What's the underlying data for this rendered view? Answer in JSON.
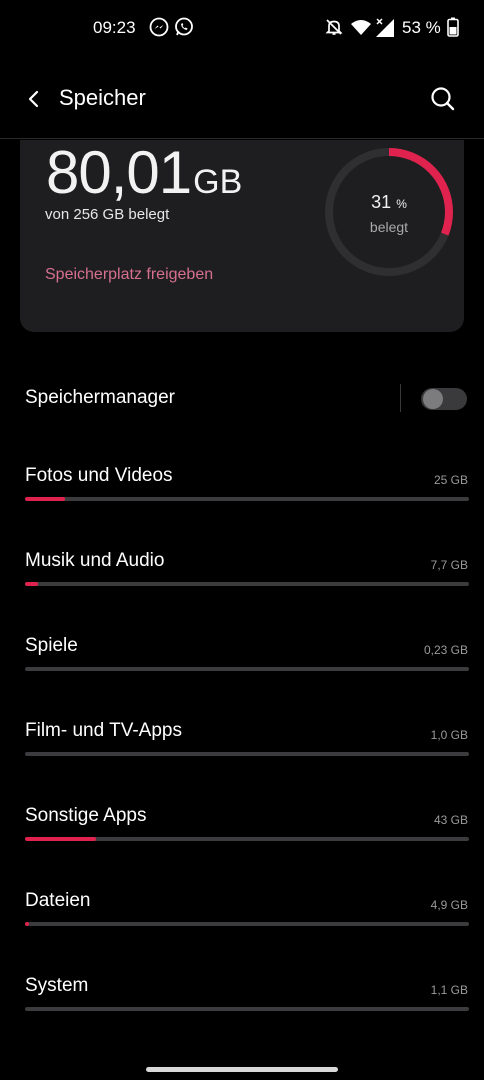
{
  "status_bar": {
    "time": "09:23",
    "battery": "53 %",
    "icons": [
      "messenger-icon",
      "whatsapp-icon",
      "bell-off-icon",
      "wifi-icon",
      "signal-icon",
      "battery-icon"
    ]
  },
  "app_bar": {
    "title": "Speicher",
    "icons": [
      "back-arrow-icon",
      "search-icon"
    ]
  },
  "summary": {
    "used_value": "80,01",
    "used_unit": "GB",
    "used_of_total": "von 256 GB belegt",
    "free_space_link": "Speicherplatz freigeben",
    "percent_value": "31",
    "percent_unit": "%",
    "percent_caption": "belegt",
    "percent_fraction": 0.31
  },
  "storage_manager": {
    "label": "Speichermanager",
    "enabled": false
  },
  "categories": [
    {
      "label": "Fotos und Videos",
      "size": "25 GB",
      "fraction": 0.09
    },
    {
      "label": "Musik und Audio",
      "size": "7,7 GB",
      "fraction": 0.03
    },
    {
      "label": "Spiele",
      "size": "0,23 GB",
      "fraction": 0.0
    },
    {
      "label": "Film- und TV-Apps",
      "size": "1,0 GB",
      "fraction": 0.0
    },
    {
      "label": "Sonstige Apps",
      "size": "43 GB",
      "fraction": 0.16
    },
    {
      "label": "Dateien",
      "size": "4,9 GB",
      "fraction": 0.01
    },
    {
      "label": "System",
      "size": "1,1 GB",
      "fraction": 0.0
    }
  ],
  "colors": {
    "accent": "#e0234e",
    "link": "#d6708e",
    "card": "#1e1e20",
    "track": "#3c3c3f"
  }
}
